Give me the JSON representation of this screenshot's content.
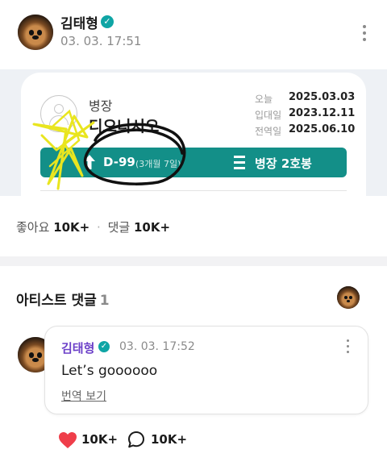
{
  "post": {
    "author": "김태형",
    "time": "03. 03. 17:51",
    "verified_icon": "verified-check-icon"
  },
  "image": {
    "rank": "병장",
    "unit": "디오니시오",
    "dates": [
      {
        "label": "오늘",
        "value": "2025.03.03"
      },
      {
        "label": "입대일",
        "value": "2023.12.11"
      },
      {
        "label": "전역일",
        "value": "2025.06.10"
      }
    ],
    "dday": "D-99",
    "dday_detail": "(3개월 7일)",
    "grade": "병장 2호봉",
    "colors": {
      "bar": "#138f88",
      "star_scribble": "#e9e51f",
      "circle_scribble": "#000000"
    }
  },
  "stats": {
    "likes_label": "좋아요",
    "likes": "10K+",
    "separator": "·",
    "comments_label": "댓글",
    "comments": "10K+"
  },
  "artist_comments": {
    "title": "아티스트 댓글",
    "count": "1",
    "comment": {
      "author": "김태형",
      "time": "03. 03. 17:52",
      "text": "Let’s goooooo",
      "translate": "번역 보기",
      "likes": "10K+",
      "replies": "10K+"
    }
  },
  "colors": {
    "accent": "#0fa5a5",
    "artist_name": "#6b3fc8",
    "heart": "#ef3e4a"
  }
}
